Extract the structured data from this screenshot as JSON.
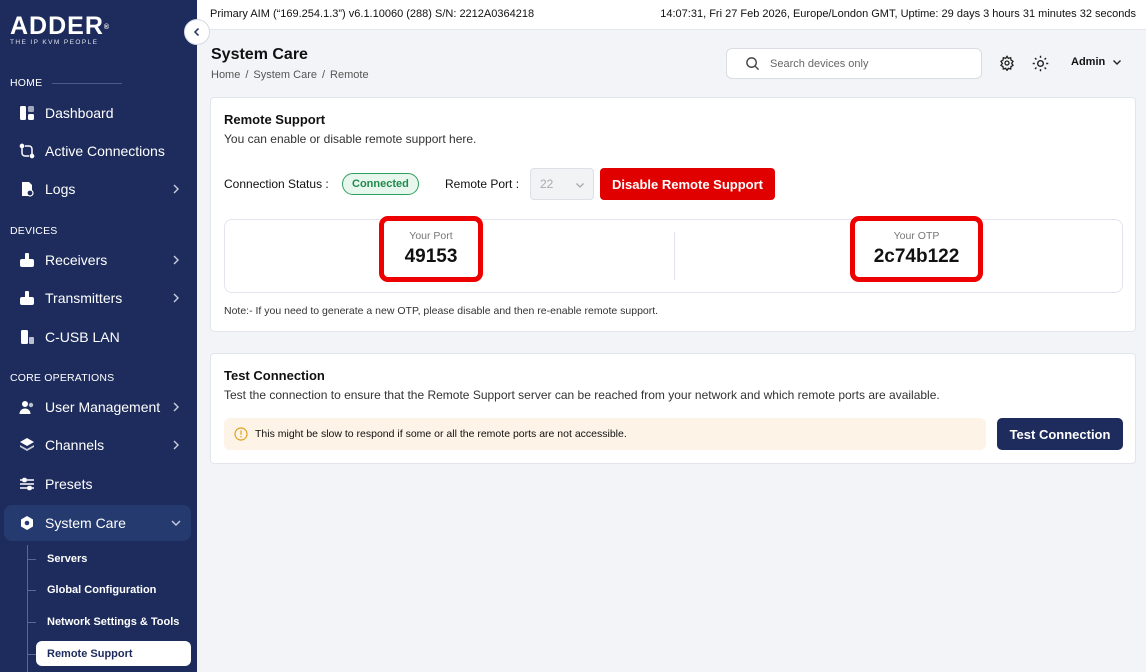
{
  "brand": {
    "name": "ADDER",
    "reg": "®",
    "tagline": "THE IP KVM PEOPLE"
  },
  "topbar": {
    "device_info": "Primary AIM (“169.254.1.3”) v6.1.10060 (288) S/N: 2212A0364218",
    "status": "14:07:31, Fri 27 Feb 2026, Europe/London GMT, Uptime: 29 days 3 hours 31 minutes 32 seconds"
  },
  "sidebar": {
    "sections": {
      "home": "HOME",
      "devices": "DEVICES",
      "core": "CORE OPERATIONS"
    },
    "items": {
      "dashboard": "Dashboard",
      "active_connections": "Active Connections",
      "logs": "Logs",
      "receivers": "Receivers",
      "transmitters": "Transmitters",
      "cusb": "C-USB LAN",
      "user_management": "User Management",
      "channels": "Channels",
      "presets": "Presets",
      "system_care": "System Care"
    },
    "subitems": {
      "servers": "Servers",
      "global_config": "Global Configuration",
      "network": "Network Settings & Tools",
      "remote_support": "Remote Support"
    }
  },
  "header": {
    "title": "System Care",
    "breadcrumb": [
      "Home",
      "/",
      "System Care",
      "/",
      "Remote"
    ],
    "search_placeholder": "Search devices only",
    "user": "Admin"
  },
  "remote_support": {
    "title": "Remote Support",
    "description": "You can enable or disable remote support here.",
    "status_label": "Connection Status :",
    "status_value": "Connected",
    "port_label": "Remote Port :",
    "port_value": "22",
    "disable_button": "Disable Remote Support",
    "your_port_label": "Your Port",
    "your_port_value": "49153",
    "your_otp_label": "Your OTP",
    "your_otp_value": "2c74b122",
    "note": "Note:- If you need to generate a new OTP, please disable and then re-enable remote support."
  },
  "test_connection": {
    "title": "Test Connection",
    "description": "Test the connection to ensure that the Remote Support server can be reached from your network and which remote ports are available.",
    "warning": "This might be slow to respond if some or all the remote ports are not accessible.",
    "button": "Test Connection"
  },
  "colors": {
    "sidebar": "#1d2c5c",
    "danger": "#e10000",
    "success": "#2e9e5b",
    "primary": "#1d2c5c",
    "highlight": "#ee0000"
  }
}
